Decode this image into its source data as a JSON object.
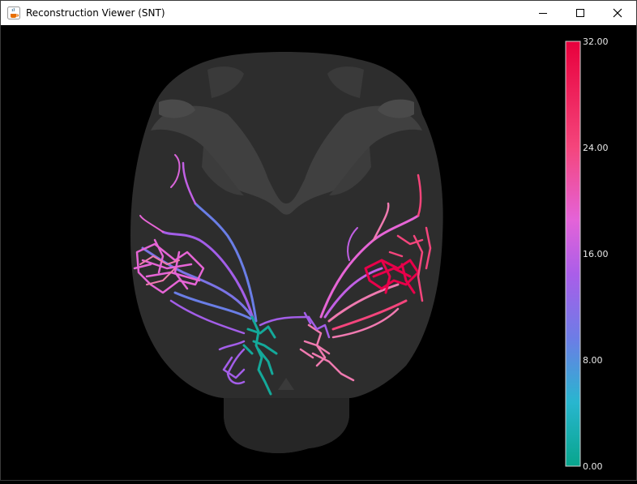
{
  "window": {
    "title": "Reconstruction Viewer (SNT)",
    "app_icon": "java-coffee-cup-icon",
    "controls": [
      "minimize-icon",
      "maximize-icon",
      "close-icon"
    ]
  },
  "viewer": {
    "background_color": "#000000",
    "brain_mesh_color": "#3a3a3a",
    "colorbar": {
      "min": 0,
      "max": 32,
      "labels": [
        "32.00",
        "24.00",
        "16.00",
        "8.00",
        "0.00"
      ],
      "colormap": [
        "#e8004a",
        "#f5457a",
        "#e665d6",
        "#a35ee8",
        "#6a7ee6",
        "#25b8cf",
        "#0aa892"
      ]
    }
  }
}
